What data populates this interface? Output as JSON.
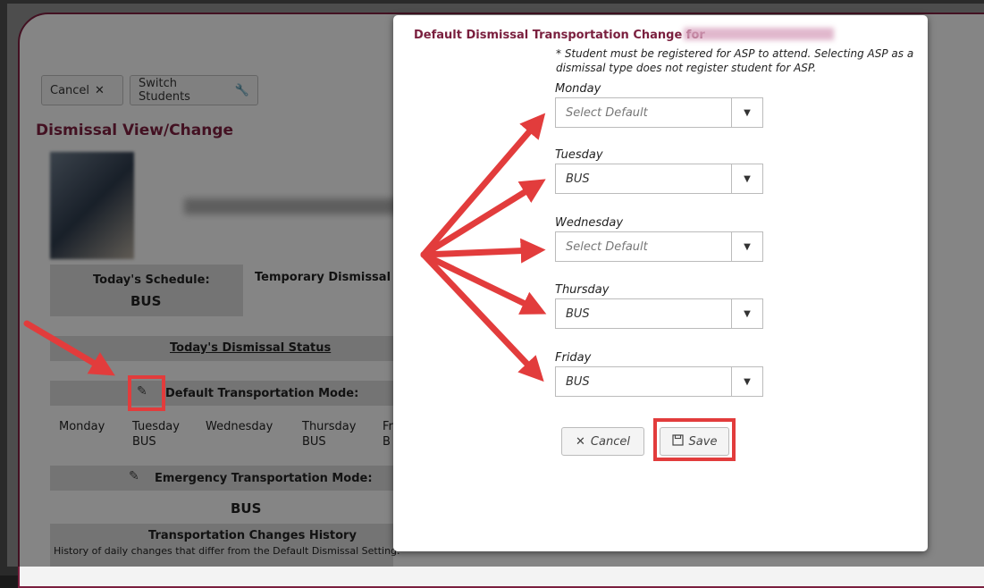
{
  "background": {
    "cancel_label": "Cancel",
    "switch_label": "Switch Students",
    "page_title": "Dismissal View/Change",
    "todays_schedule_label": "Today's Schedule:",
    "todays_schedule_value": "BUS",
    "temp_change_label": "Temporary Dismissal Ch",
    "todays_status_label": "Today's Dismissal Status",
    "default_mode_label": "Default Transportation Mode:",
    "days": [
      {
        "name": "Monday",
        "value": ""
      },
      {
        "name": "Tuesday",
        "value": "BUS"
      },
      {
        "name": "Wednesday",
        "value": ""
      },
      {
        "name": "Thursday",
        "value": "BUS"
      },
      {
        "name": "Fr",
        "value": "B"
      }
    ],
    "emergency_label": "Emergency Transportation Mode:",
    "emergency_value": "BUS",
    "history_title": "Transportation Changes History",
    "history_desc": "History of daily changes that differ from the Default Dismissal Setting."
  },
  "modal": {
    "title": "Default Dismissal Transportation Change for",
    "note": "* Student must be registered for ASP to attend. Selecting ASP as a dismissal type does not register student for ASP.",
    "days": [
      {
        "label": "Monday",
        "value": "Select Default"
      },
      {
        "label": "Tuesday",
        "value": "BUS"
      },
      {
        "label": "Wednesday",
        "value": "Select Default"
      },
      {
        "label": "Thursday",
        "value": "BUS"
      },
      {
        "label": "Friday",
        "value": "BUS"
      }
    ],
    "cancel_label": "Cancel",
    "save_label": "Save"
  },
  "colors": {
    "accent": "#7a1f3e",
    "annotation": "#e23c3c"
  }
}
